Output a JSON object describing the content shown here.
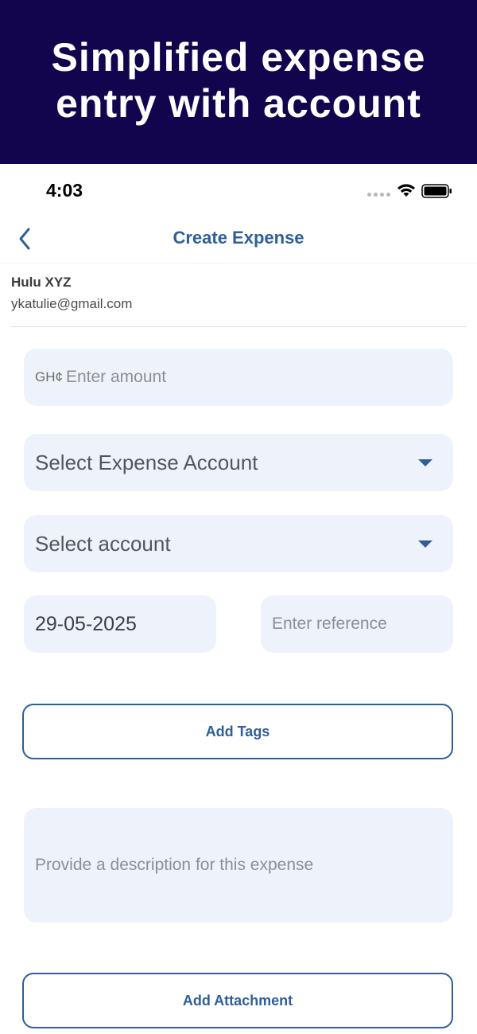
{
  "banner": {
    "title": "Simplified expense entry with account"
  },
  "status_bar": {
    "time": "4:03"
  },
  "nav": {
    "title": "Create Expense"
  },
  "user": {
    "name": "Hulu XYZ",
    "email": "ykatulie@gmail.com"
  },
  "form": {
    "amount": {
      "currency": "GH¢",
      "placeholder": "Enter amount"
    },
    "expense_account": {
      "placeholder": "Select Expense Account"
    },
    "account": {
      "placeholder": "Select account"
    },
    "date": {
      "value": "29-05-2025"
    },
    "reference": {
      "placeholder": "Enter reference"
    },
    "add_tags_label": "Add Tags",
    "description": {
      "placeholder": "Provide a description for this expense"
    },
    "add_attachment_label": "Add Attachment"
  },
  "colors": {
    "banner": "#12054e",
    "accent": "#2f5e99",
    "field_bg": "#eef2fb"
  },
  "icons": {
    "back": "chevron-left-icon",
    "dropdown": "caret-down-icon",
    "wifi": "wifi-icon",
    "battery": "battery-icon",
    "signal": "signal-icon"
  }
}
